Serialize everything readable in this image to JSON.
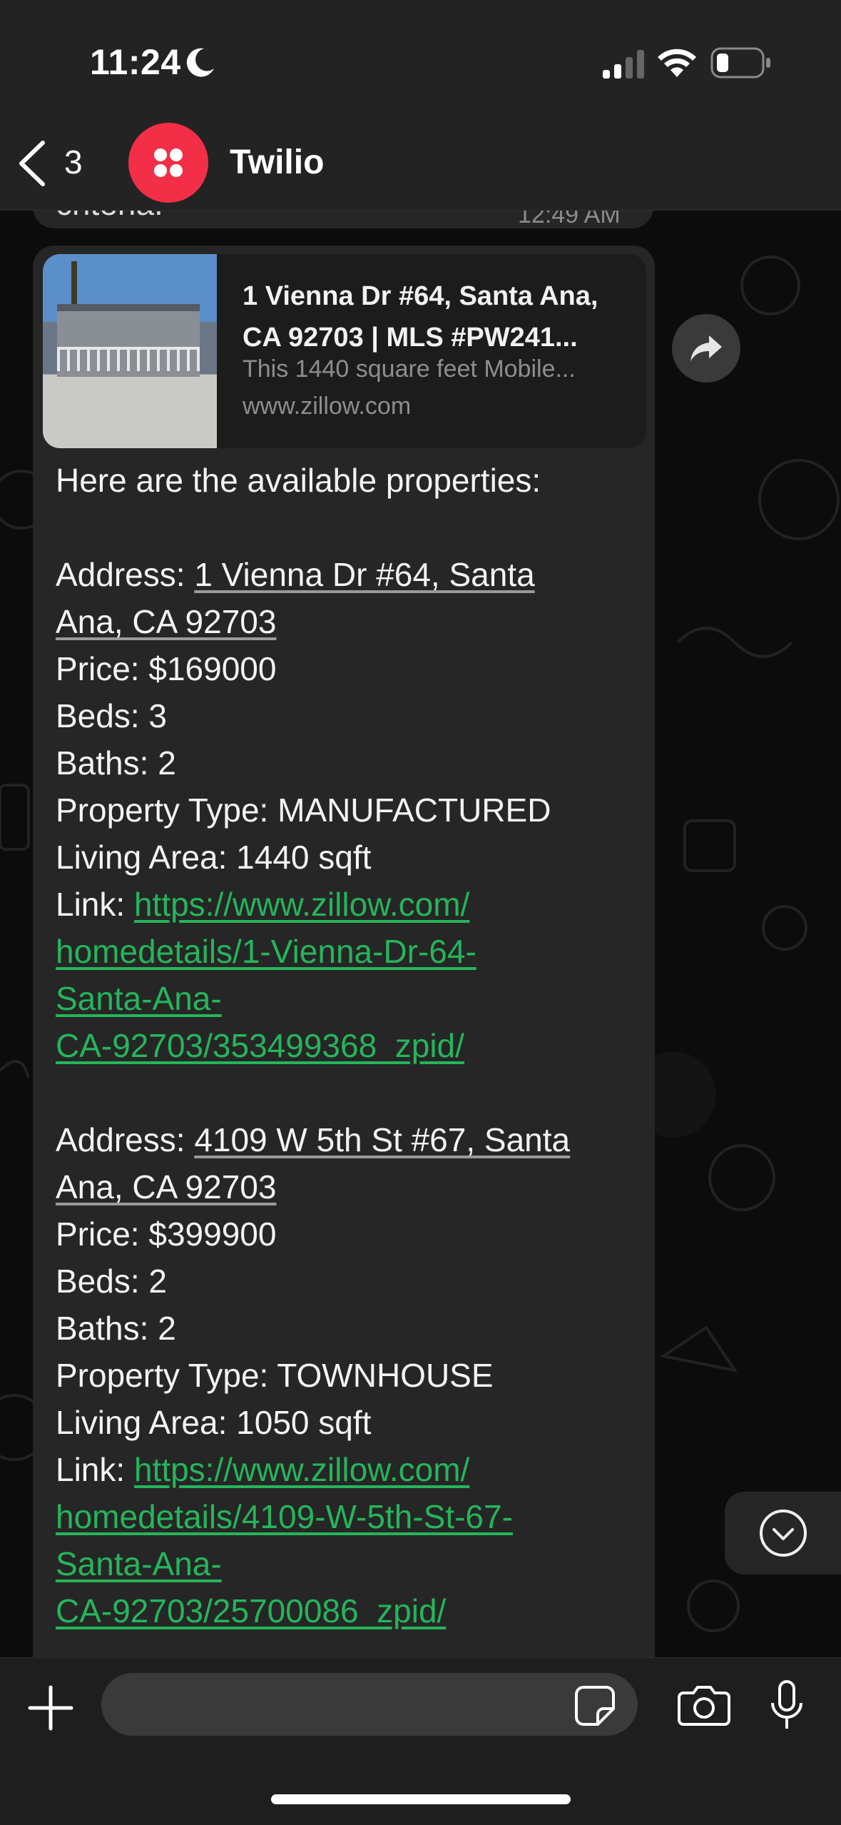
{
  "status_bar": {
    "time": "11:24"
  },
  "header": {
    "back_count": "3",
    "contact_name": "Twilio"
  },
  "previous_message": {
    "partial_text": "criteria.",
    "time": "12:49 AM"
  },
  "link_preview": {
    "title": "1 Vienna Dr #64, Santa Ana, CA 92703 | MLS #PW241...",
    "title_line1": "1 Vienna Dr #64, Santa Ana,",
    "title_line2": "CA 92703 | MLS #PW241...",
    "description": "This 1440 square feet Mobile...",
    "domain": "www.zillow.com"
  },
  "message": {
    "intro": "Here are the available properties:",
    "properties": [
      {
        "address_label": "Address: ",
        "address_line1": "1 Vienna Dr #64, Santa",
        "address_line2": "Ana, CA 92703",
        "price": "Price: $169000",
        "beds": "Beds: 3",
        "baths": "Baths: 2",
        "type": "Property Type: MANUFACTURED",
        "area": "Living Area: 1440 sqft",
        "link_label": "Link: ",
        "link_lines": [
          "https://www.zillow.com/",
          "homedetails/1-Vienna-Dr-64-",
          "Santa-Ana-",
          "CA-92703/353499368_zpid/"
        ]
      },
      {
        "address_label": "Address: ",
        "address_line1": "4109 W 5th St #67, Santa",
        "address_line2": "Ana, CA 92703",
        "price": "Price: $399900",
        "beds": "Beds: 2",
        "baths": "Baths: 2",
        "type": "Property Type: TOWNHOUSE",
        "area": "Living Area: 1050 sqft",
        "link_label": "Link: ",
        "link_lines": [
          "https://www.zillow.com/",
          "homedetails/4109-W-5th-St-67-",
          "Santa-Ana-",
          "CA-92703/25700086_zpid/"
        ]
      }
    ]
  },
  "icons": {
    "back": "chevron-left-icon",
    "forward": "forward-icon",
    "scroll_down": "chevron-down-circle-icon",
    "plus": "plus-icon",
    "sticker": "sticker-icon",
    "camera": "camera-icon",
    "mic": "microphone-icon"
  },
  "colors": {
    "link": "#25b55b",
    "brand": "#f22f46",
    "bubble": "#262626"
  }
}
